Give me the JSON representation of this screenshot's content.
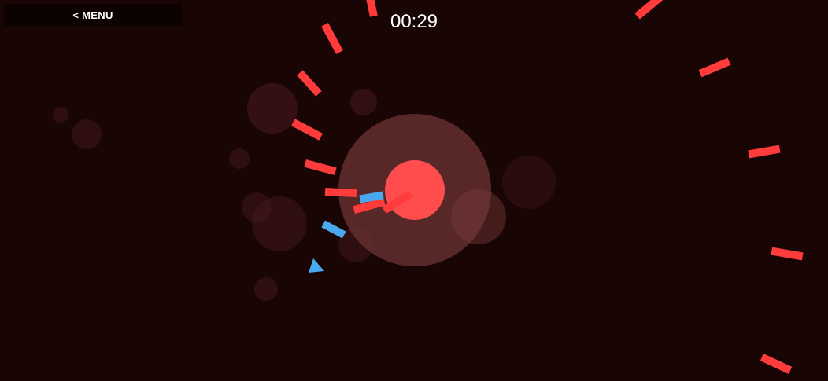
{
  "menu": {
    "label": "< MENU"
  },
  "hud": {
    "timer": "00:29"
  },
  "colors": {
    "background": "#1a0505",
    "enemy_bar": "#ff3b3b",
    "player_bar": "#4aa8f0",
    "core": "#ff4d4d",
    "aura": "#6e3434",
    "bubble": "#4a1a1f"
  },
  "icons": {
    "player": "triangle-ship-icon"
  }
}
